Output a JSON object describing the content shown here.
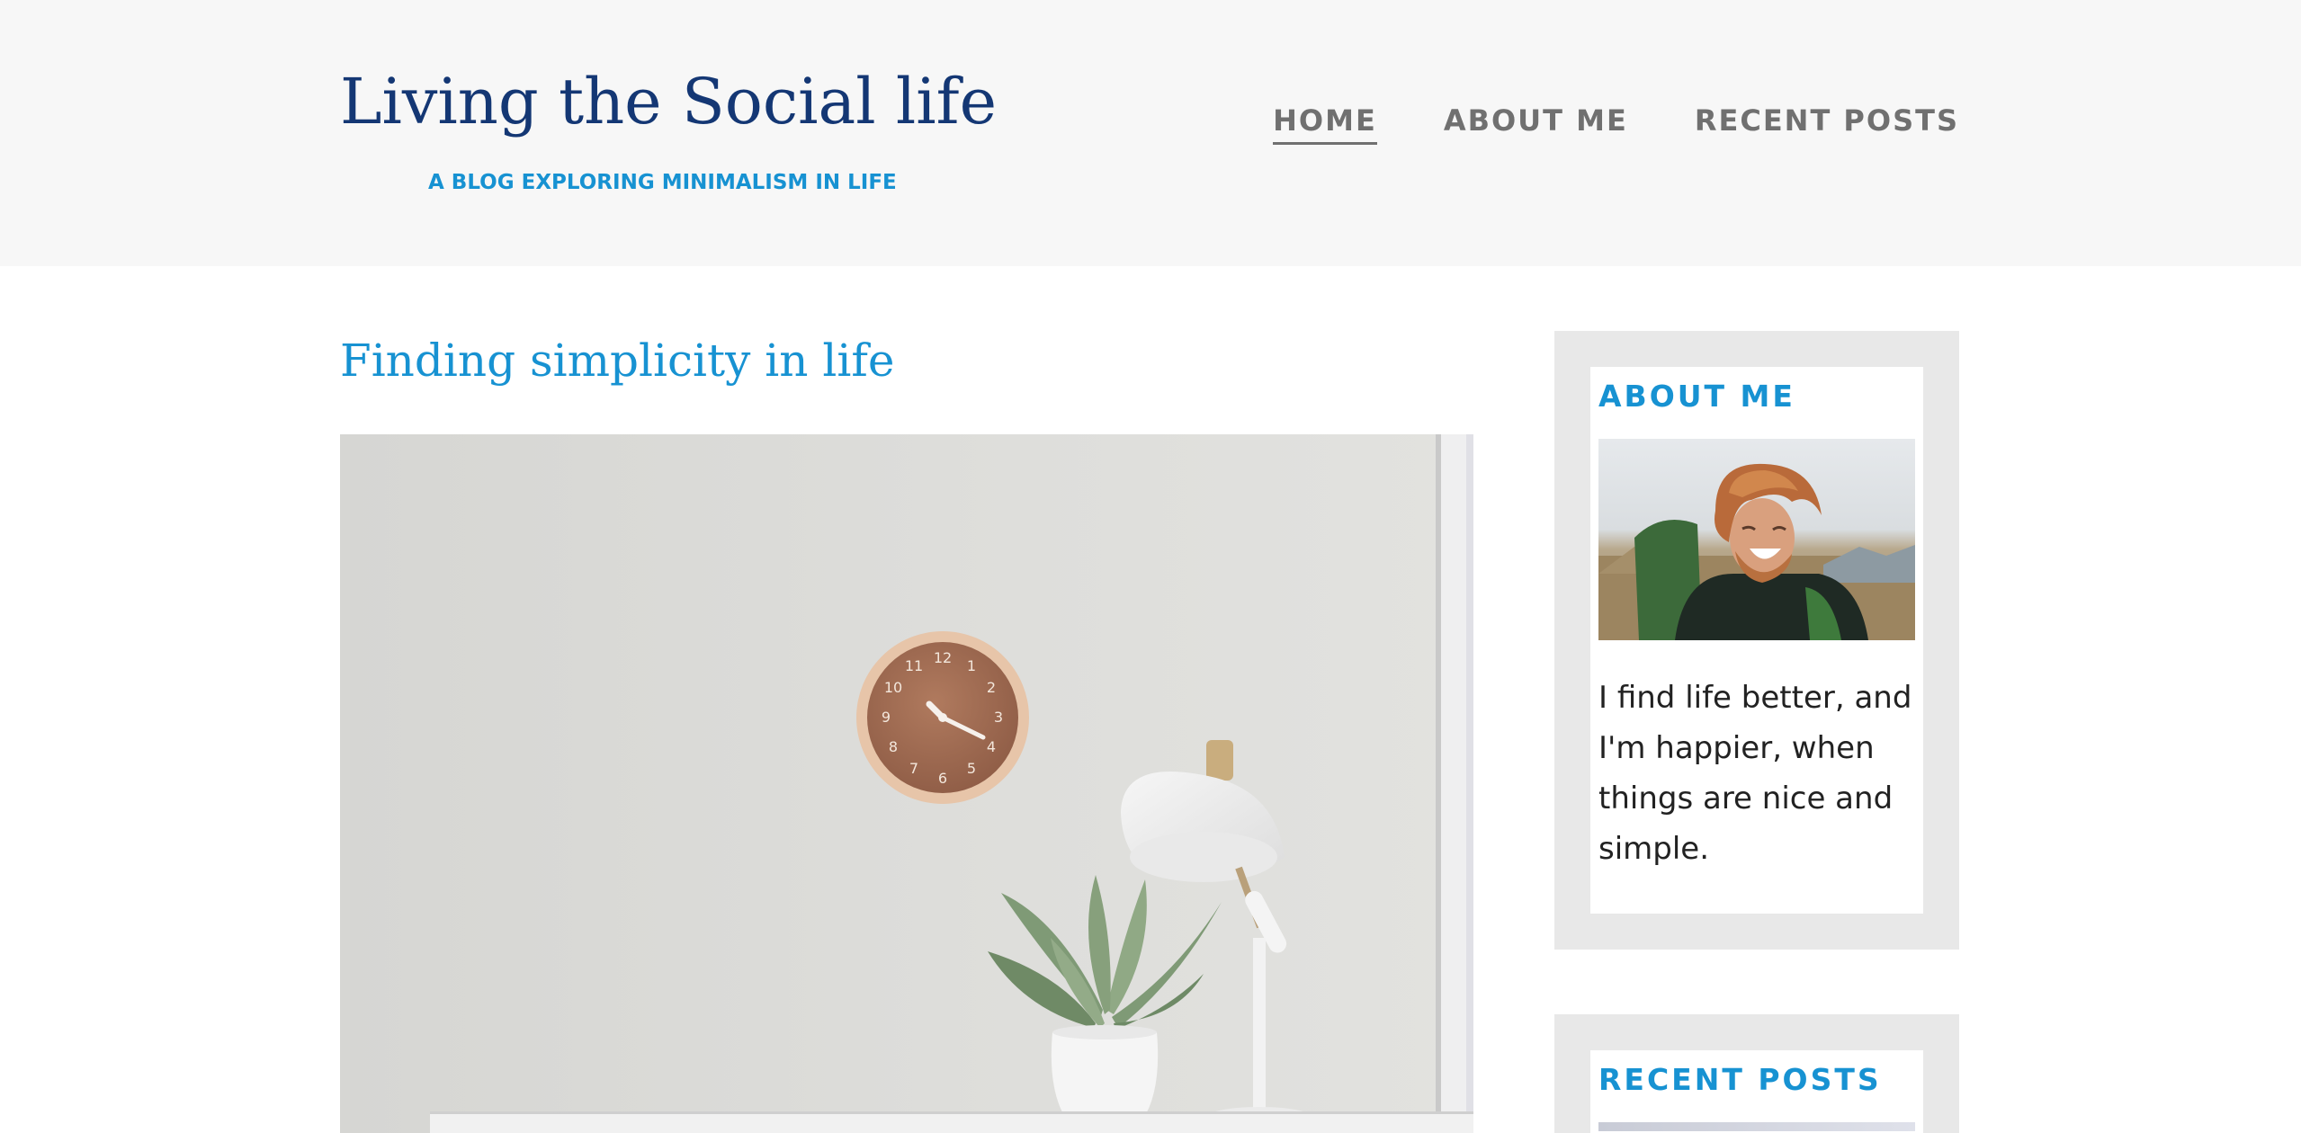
{
  "header": {
    "site_title": "Living the Social life",
    "subtitle": "A BLOG EXPLORING MINIMALISM IN LIFE",
    "nav": [
      {
        "label": "HOME",
        "current": true
      },
      {
        "label": "ABOUT ME",
        "current": false
      },
      {
        "label": "RECENT POSTS",
        "current": false
      }
    ]
  },
  "main": {
    "article_title": "Finding simplicity in life",
    "image": "desk-with-clock-lamp-and-plant"
  },
  "sidebar": {
    "about": {
      "title": "ABOUT ME",
      "photo": "laughing-man-portrait",
      "text": "I find life better, and I'm happier, when things are nice and simple."
    },
    "recent": {
      "title": "RECENT POSTS"
    }
  },
  "colors": {
    "header_bg": "#f7f7f7",
    "title_navy": "#143774",
    "accent_blue": "#1792d2",
    "nav_gray": "#707070",
    "widget_bg": "#e8e8e8"
  }
}
